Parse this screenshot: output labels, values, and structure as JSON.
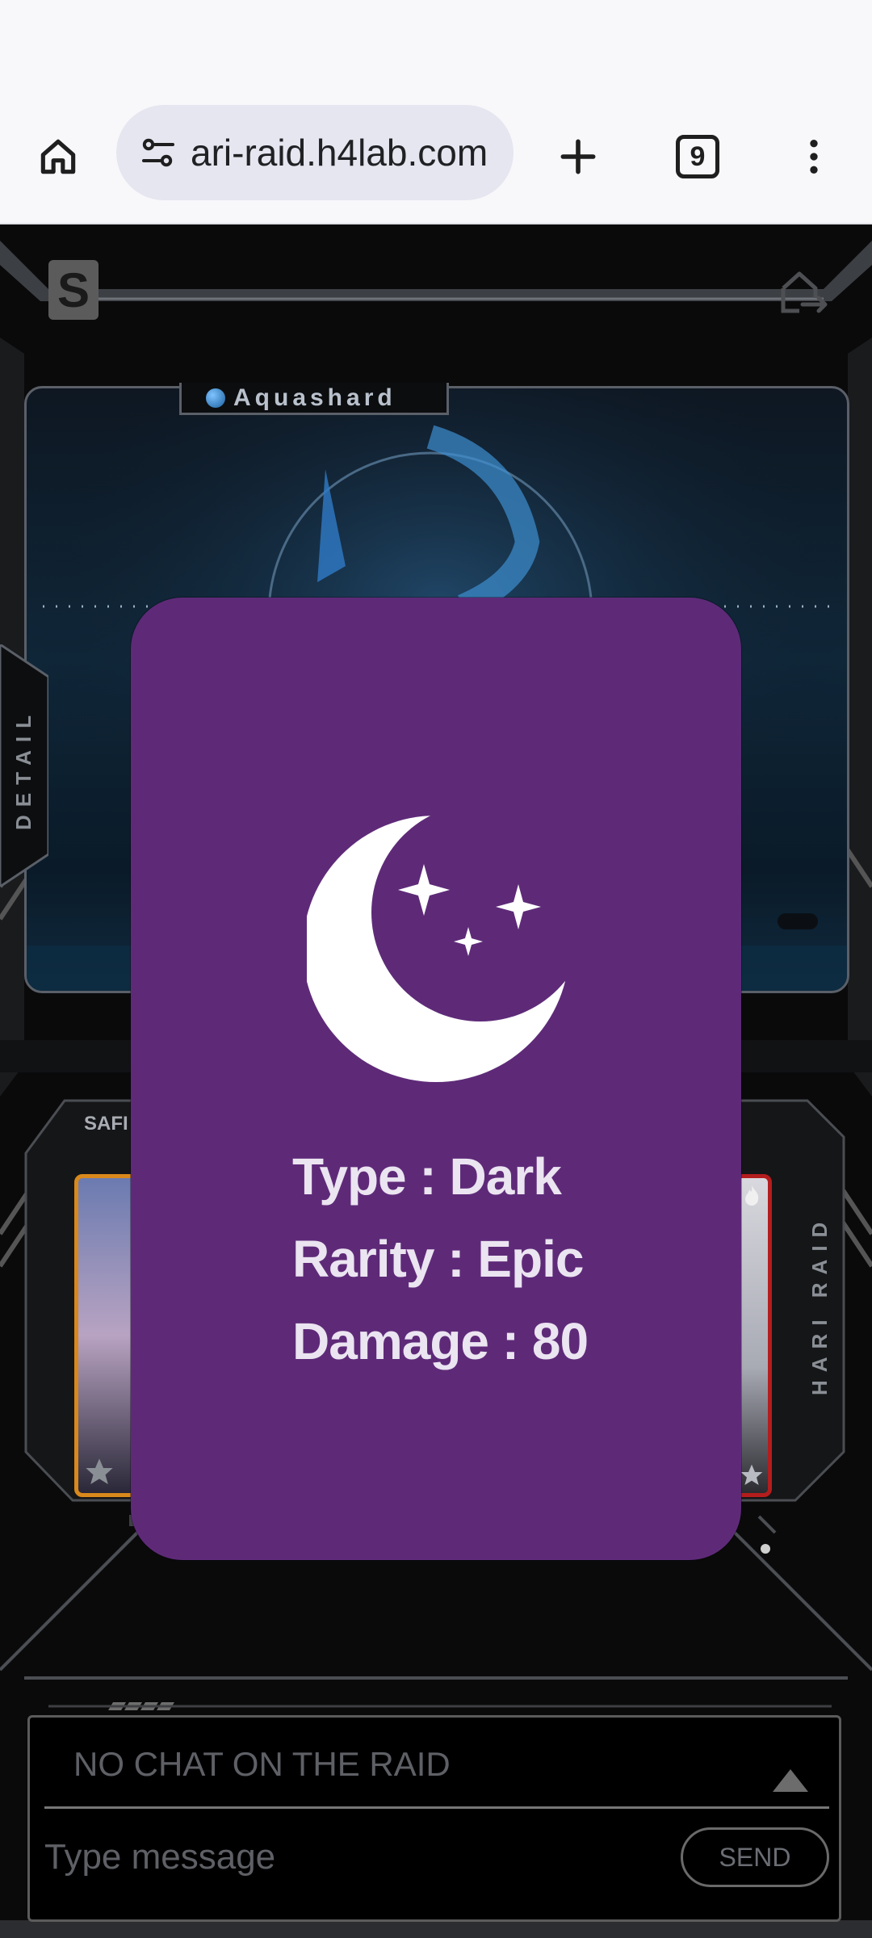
{
  "browser": {
    "url_text": "ari-raid.h4lab.com",
    "tab_count": "9"
  },
  "game": {
    "boss_name": "Aquashard",
    "detail_label": "DETAIL",
    "left_card_label": "SAFI",
    "right_label": "HARI RAID"
  },
  "card_modal": {
    "icon": "crescent-moon-stars-icon",
    "type_line": "Type : Dark",
    "rarity_line": "Rarity : Epic",
    "damage_line": "Damage : 80",
    "background_color": "#5e2a78"
  },
  "chat": {
    "empty_message": "NO CHAT ON THE RAID",
    "input_placeholder": "Type message",
    "send_label": "SEND"
  }
}
